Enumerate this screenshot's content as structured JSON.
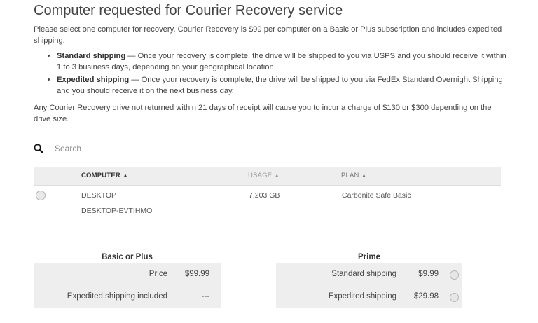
{
  "page": {
    "title": "Computer requested for Courier Recovery service",
    "intro": "Please select one computer for recovery. Courier Recovery is $99 per computer on a Basic or Plus subscription and includes expedited shipping.",
    "bullets": [
      {
        "term": "Standard shipping",
        "text": " — Once your recovery is complete, the drive will be shipped to you via USPS and you should receive it within 1 to 3 business days, depending on your geographical location."
      },
      {
        "term": "Expedited shipping",
        "text": " — Once your recovery is complete, the drive will be shipped to you via FedEx Standard Overnight Shipping and you should receive it on the next business day."
      }
    ],
    "notice": "Any Courier Recovery drive not returned within 21 days of receipt will cause you to incur a charge of $130 or $300 depending on the drive size."
  },
  "search": {
    "placeholder": "Search",
    "icon": "search-icon"
  },
  "table": {
    "columns": [
      {
        "label": "COMPUTER",
        "sort_icon": "sort-icon"
      },
      {
        "label": "USAGE",
        "sort_icon": "sort-icon"
      },
      {
        "label": "PLAN",
        "sort_icon": "sort-icon"
      }
    ],
    "rows": [
      {
        "name": "DESKTOP",
        "id": "DESKTOP-EVTIHMO",
        "usage": "7.203 GB",
        "plan": "Carbonite Safe Basic"
      }
    ]
  },
  "pricing": {
    "basic": {
      "title": "Basic or Plus",
      "rows": [
        {
          "label": "Price",
          "value": "$99.99"
        },
        {
          "label": "Expedited shipping included",
          "value": "---"
        }
      ]
    },
    "prime": {
      "title": "Prime",
      "rows": [
        {
          "label": "Standard shipping",
          "value": "$9.99"
        },
        {
          "label": "Expedited shipping",
          "value": "$29.98"
        }
      ]
    }
  }
}
